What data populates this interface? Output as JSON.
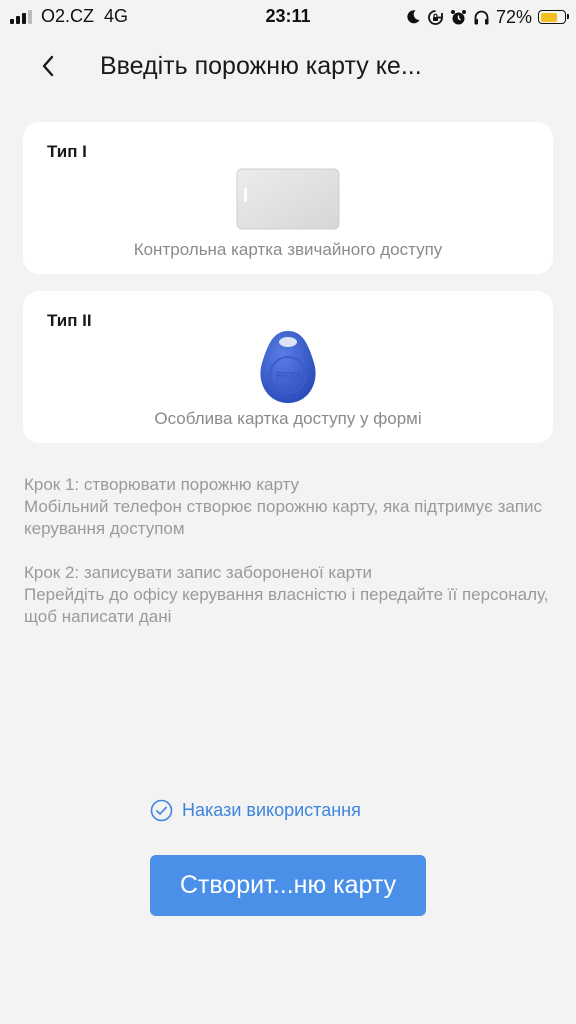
{
  "status_bar": {
    "carrier": "O2.CZ",
    "network": "4G",
    "time": "23:11",
    "battery_percent": "72%",
    "battery_level": 0.72,
    "battery_color": "#f2c01e",
    "icons": [
      "signal-icon",
      "moon-icon",
      "rotation-lock-icon",
      "alarm-icon",
      "headphones-icon",
      "battery-icon"
    ]
  },
  "header": {
    "back_icon": "chevron-left-icon",
    "title": "Введіть порожню карту ке..."
  },
  "cards": [
    {
      "label": "Тип I",
      "caption": "Контрольна картка звичайного доступу",
      "image": "access-card-image"
    },
    {
      "label": "Тип II",
      "caption": "Особлива картка доступу у формі",
      "image": "key-fob-image"
    }
  ],
  "steps": {
    "step1_title": "Крок 1: створювати порожню карту",
    "step1_desc": "Мобільний телефон створює порожню карту, яка підтримує запис керування доступом",
    "step2_title": "Крок 2: записувати запис забороненої карти",
    "step2_desc": "Перейдіть до офісу керування власністю і передайте її персоналу, щоб написати дані"
  },
  "terms": {
    "icon": "check-circle-icon",
    "label": "Накази використання",
    "accent_color": "#3d85e0"
  },
  "primary_button": {
    "label": "Створит...ню карту",
    "color": "#4a90e8"
  }
}
